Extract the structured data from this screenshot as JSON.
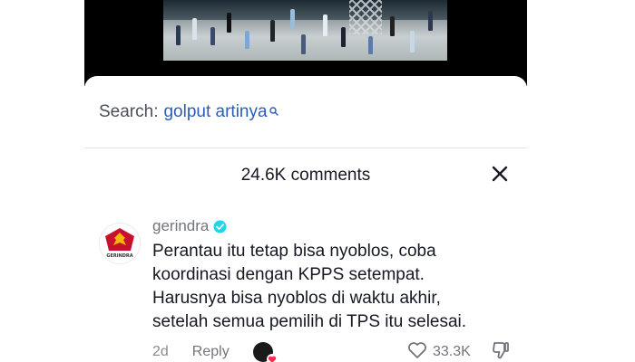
{
  "search": {
    "prefix": "Search:",
    "query": "golput artinya"
  },
  "comments_header": {
    "count_text": "24.6K comments"
  },
  "comment": {
    "username": "gerindra",
    "verified": true,
    "lines": [
      "Perantau itu tetap bisa nyoblos, coba",
      "koordinasi dengan KPPS setempat.",
      "Harusnya bisa nyoblos di waktu akhir,",
      "setelah semua pemilih di TPS itu selesai."
    ],
    "avatar_logo_text": "GERINDRA",
    "time": "2d",
    "reply_label": "Reply",
    "like_count": "33.3K"
  },
  "colors": {
    "accent_link": "#2b5db8",
    "verified_blue": "#20d5ec",
    "heart_red": "#fe2c55",
    "logo_red": "#c8102e",
    "logo_gold": "#f2b705"
  },
  "icons": {
    "search": "search-icon",
    "close": "close-icon",
    "verified": "verified-badge-icon",
    "like": "heart-outline-icon",
    "dislike": "thumbs-down-icon"
  }
}
